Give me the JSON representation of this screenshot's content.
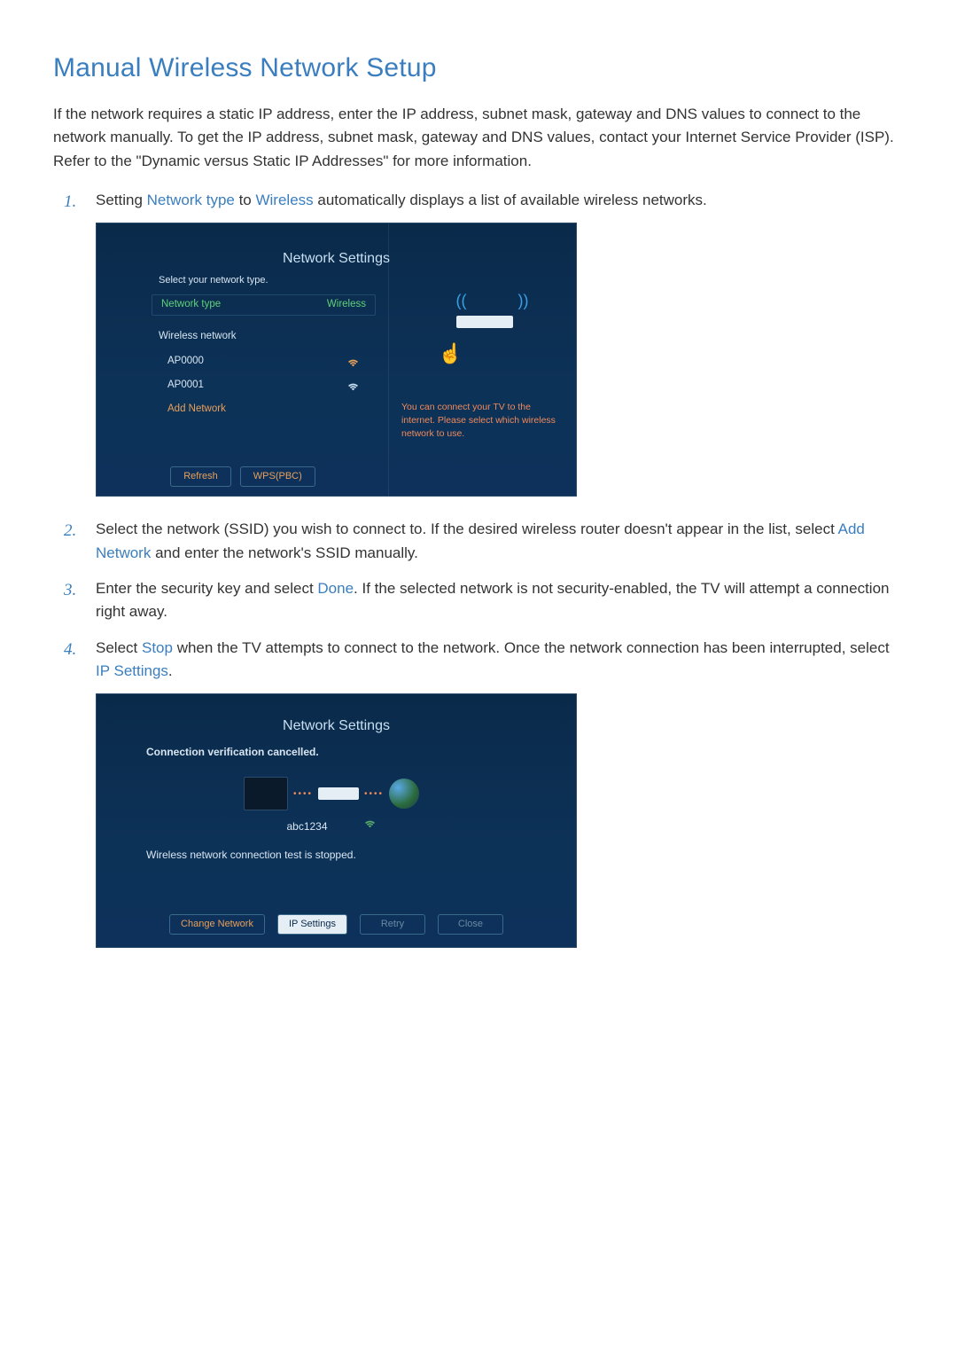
{
  "title": "Manual Wireless Network Setup",
  "intro": "If the network requires a static IP address, enter the IP address, subnet mask, gateway and DNS values to connect to the network manually. To get the IP address, subnet mask, gateway and DNS values, contact your Internet Service Provider (ISP). Refer to the \"Dynamic versus Static IP Addresses\" for more information.",
  "steps": {
    "s1a": "Setting ",
    "s1kw1": "Network type",
    "s1b": " to ",
    "s1kw2": "Wireless",
    "s1c": " automatically displays a list of available wireless networks.",
    "s2a": "Select the network (SSID) you wish to connect to. If the desired wireless router doesn't appear in the list, select ",
    "s2kw": "Add Network",
    "s2b": " and enter the network's SSID manually.",
    "s3a": "Enter the security key and select ",
    "s3kw": "Done",
    "s3b": ". If the selected network is not security-enabled, the TV will attempt a connection right away.",
    "s4a": "Select ",
    "s4kw1": "Stop",
    "s4b": " when the TV attempts to connect to the network. Once the network connection has been interrupted, select ",
    "s4kw2": "IP Settings",
    "s4c": "."
  },
  "scr1": {
    "title": "Network Settings",
    "hint": "Select your network type.",
    "network_type_label": "Network type",
    "network_type_value": "Wireless",
    "wireless_section": "Wireless network",
    "ap0": "AP0000",
    "ap1": "AP0001",
    "add_network": "Add Network",
    "refresh": "Refresh",
    "wps": "WPS(PBC)",
    "right_text": "You can connect your TV to the internet. Please select which wireless network to use."
  },
  "scr2": {
    "title": "Network Settings",
    "msg1": "Connection verification cancelled.",
    "ssid": "abc1234",
    "msg2": "Wireless network connection test is stopped.",
    "change_network": "Change Network",
    "ip_settings": "IP Settings",
    "retry": "Retry",
    "close": "Close"
  }
}
